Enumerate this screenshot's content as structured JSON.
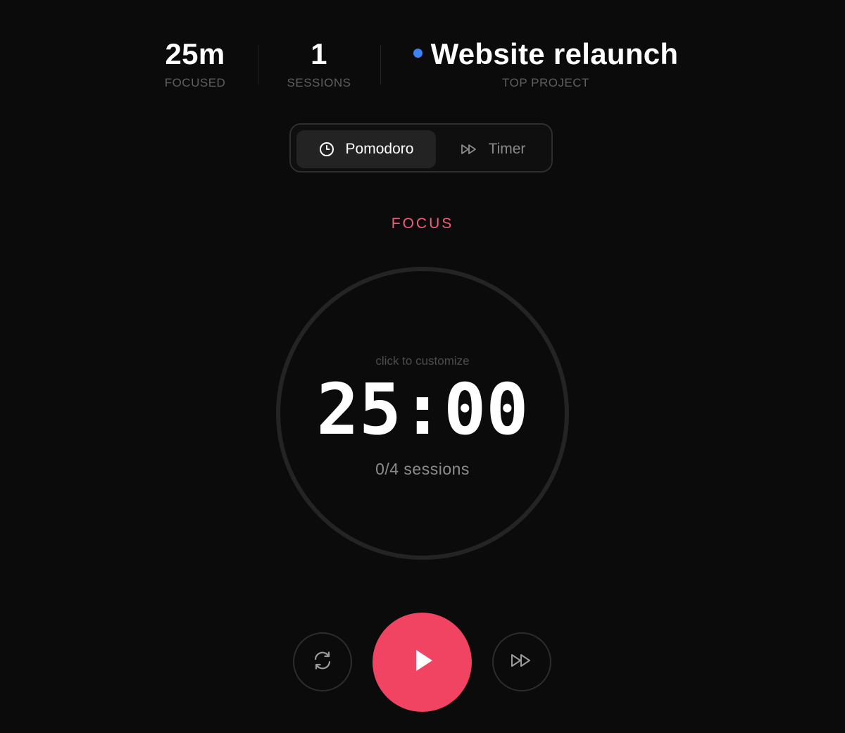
{
  "stats": {
    "focused": {
      "value": "25m",
      "label": "FOCUSED"
    },
    "sessions": {
      "value": "1",
      "label": "SESSIONS"
    },
    "top_project": {
      "value": "Website relaunch",
      "label": "TOP PROJECT",
      "dot_color": "#3b82f6"
    }
  },
  "modes": {
    "active": "pomodoro",
    "pomodoro": {
      "label": "Pomodoro",
      "icon": "clock-icon"
    },
    "timer": {
      "label": "Timer",
      "icon": "fast-forward-icon"
    }
  },
  "phase": {
    "label": "FOCUS",
    "color": "#f05d79"
  },
  "timer": {
    "hint": "click to customize",
    "time": "25:00",
    "sessions": "0/4 sessions"
  },
  "controls": {
    "reset": {
      "icon": "refresh-icon"
    },
    "play": {
      "icon": "play-icon",
      "color": "#f04462"
    },
    "skip": {
      "icon": "skip-forward-icon"
    }
  }
}
